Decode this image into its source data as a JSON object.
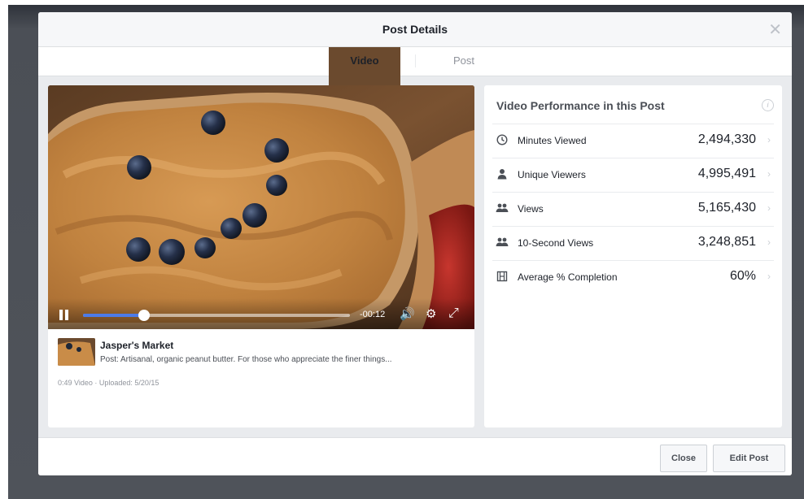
{
  "modal": {
    "title": "Post Details",
    "close_icon": "close-icon"
  },
  "tabs": [
    {
      "label": "Video",
      "active": true
    },
    {
      "label": "Post",
      "active": false
    }
  ],
  "player": {
    "state": "playing",
    "progress": 0.23,
    "time_remaining": "-00:12",
    "icons": [
      "pause-icon",
      "volume-icon",
      "gear-icon",
      "fullscreen-icon"
    ]
  },
  "post_meta": {
    "page_name": "Jasper's Market",
    "post_text": "Post: Artisanal, organic peanut butter. For those who appreciate the finer things...",
    "video_info": "0:49 Video  ·  Uploaded: 5/20/15"
  },
  "performance": {
    "title": "Video Performance in this Post",
    "metrics": [
      {
        "icon": "clock-icon",
        "label": "Minutes Viewed",
        "value": "2,494,330"
      },
      {
        "icon": "person-icon",
        "label": "Unique Viewers",
        "value": "4,995,491"
      },
      {
        "icon": "people-icon",
        "label": "Views",
        "value": "5,165,430"
      },
      {
        "icon": "people-icon",
        "label": "10-Second Views",
        "value": "3,248,851"
      },
      {
        "icon": "film-icon",
        "label": "Average % Completion",
        "value": "60%"
      }
    ]
  },
  "footer": {
    "close_label": "Close",
    "edit_label": "Edit Post"
  },
  "colors": {
    "accent": "#4267b2",
    "progress": "#4c7be8",
    "modal_bg": "#e9ebee"
  }
}
